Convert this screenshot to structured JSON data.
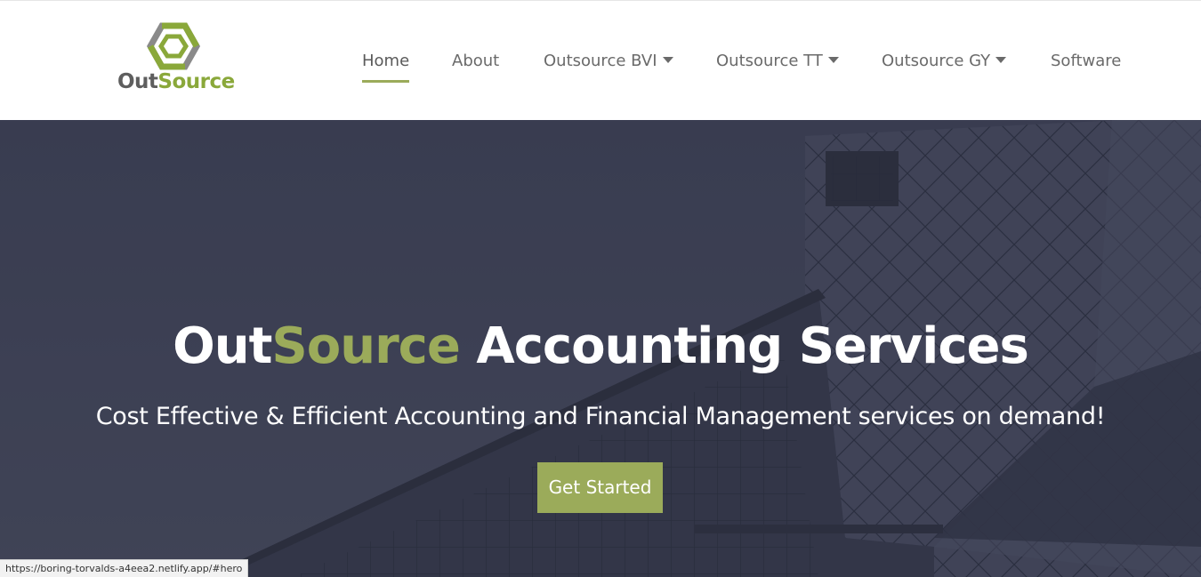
{
  "brand": {
    "name_part1": "Out",
    "name_part2": "Source",
    "colors": {
      "gray": "#5e5e5e",
      "green": "#8aa83a",
      "accent": "#9bab5a"
    }
  },
  "nav": {
    "items": [
      {
        "label": "Home",
        "active": true,
        "dropdown": false
      },
      {
        "label": "About",
        "active": false,
        "dropdown": false
      },
      {
        "label": "Outsource BVI",
        "active": false,
        "dropdown": true
      },
      {
        "label": "Outsource TT",
        "active": false,
        "dropdown": true
      },
      {
        "label": "Outsource GY",
        "active": false,
        "dropdown": true
      },
      {
        "label": "Software",
        "active": false,
        "dropdown": false
      }
    ]
  },
  "hero": {
    "title_part1": "Out",
    "title_part2": "Source",
    "title_part3": " Accounting Services",
    "subtitle": "Cost Effective & Efficient Accounting and Financial Management services on demand!",
    "cta_label": "Get Started"
  },
  "status_bar": {
    "url": "https://boring-torvalds-a4eea2.netlify.app/#hero"
  }
}
